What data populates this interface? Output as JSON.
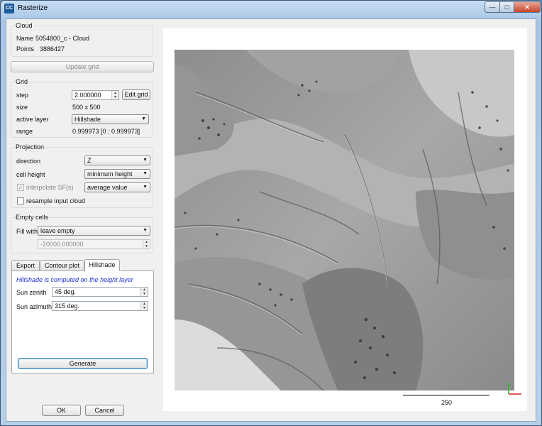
{
  "window": {
    "title": "Rasterize",
    "app_icon_text": "CC",
    "minimize_glyph": "—",
    "maximize_glyph": "□",
    "close_glyph": "✕"
  },
  "cloud": {
    "title": "Cloud",
    "name_label": "Name",
    "name_value": "5054800_c - Cloud",
    "points_label": "Points",
    "points_value": "3886427"
  },
  "update_grid_label": "Update grid",
  "grid": {
    "title": "Grid",
    "step_label": "step",
    "step_value": "2.000000",
    "edit_grid_label": "Edit grid",
    "size_label": "size",
    "size_value": "500 x 500",
    "active_layer_label": "active layer",
    "active_layer_value": "Hillshade",
    "range_label": "range",
    "range_value": "0.999973 [0 ; 0.999973]"
  },
  "projection": {
    "title": "Projection",
    "direction_label": "direction",
    "direction_value": "Z",
    "cell_height_label": "cell height",
    "cell_height_value": "minimum height",
    "interpolate_label": "interpolate SF(s)",
    "interpolate_checked": true,
    "interpolate_value": "average value",
    "resample_label": "resample input cloud",
    "resample_checked": false
  },
  "empty_cells": {
    "title": "Empty cells",
    "fill_with_label": "Fill with",
    "fill_with_value": "leave empty",
    "fill_value": "-20000.000000"
  },
  "tabs": [
    {
      "label": "Export"
    },
    {
      "label": "Contour plot"
    },
    {
      "label": "Hillshade"
    }
  ],
  "active_tab": "Hillshade",
  "hillshade": {
    "info": "Hillshade is computed on the height layer",
    "sun_zenith_label": "Sun zenith",
    "sun_zenith_value": "45 deg.",
    "sun_azimuth_label": "Sun azimuth",
    "sun_azimuth_value": "315 deg.",
    "generate_label": "Generate"
  },
  "footer": {
    "ok_label": "OK",
    "cancel_label": "Cancel"
  },
  "preview": {
    "scale_value": "250",
    "axis_colors": {
      "x": "#e02020",
      "y": "#20c020"
    }
  }
}
